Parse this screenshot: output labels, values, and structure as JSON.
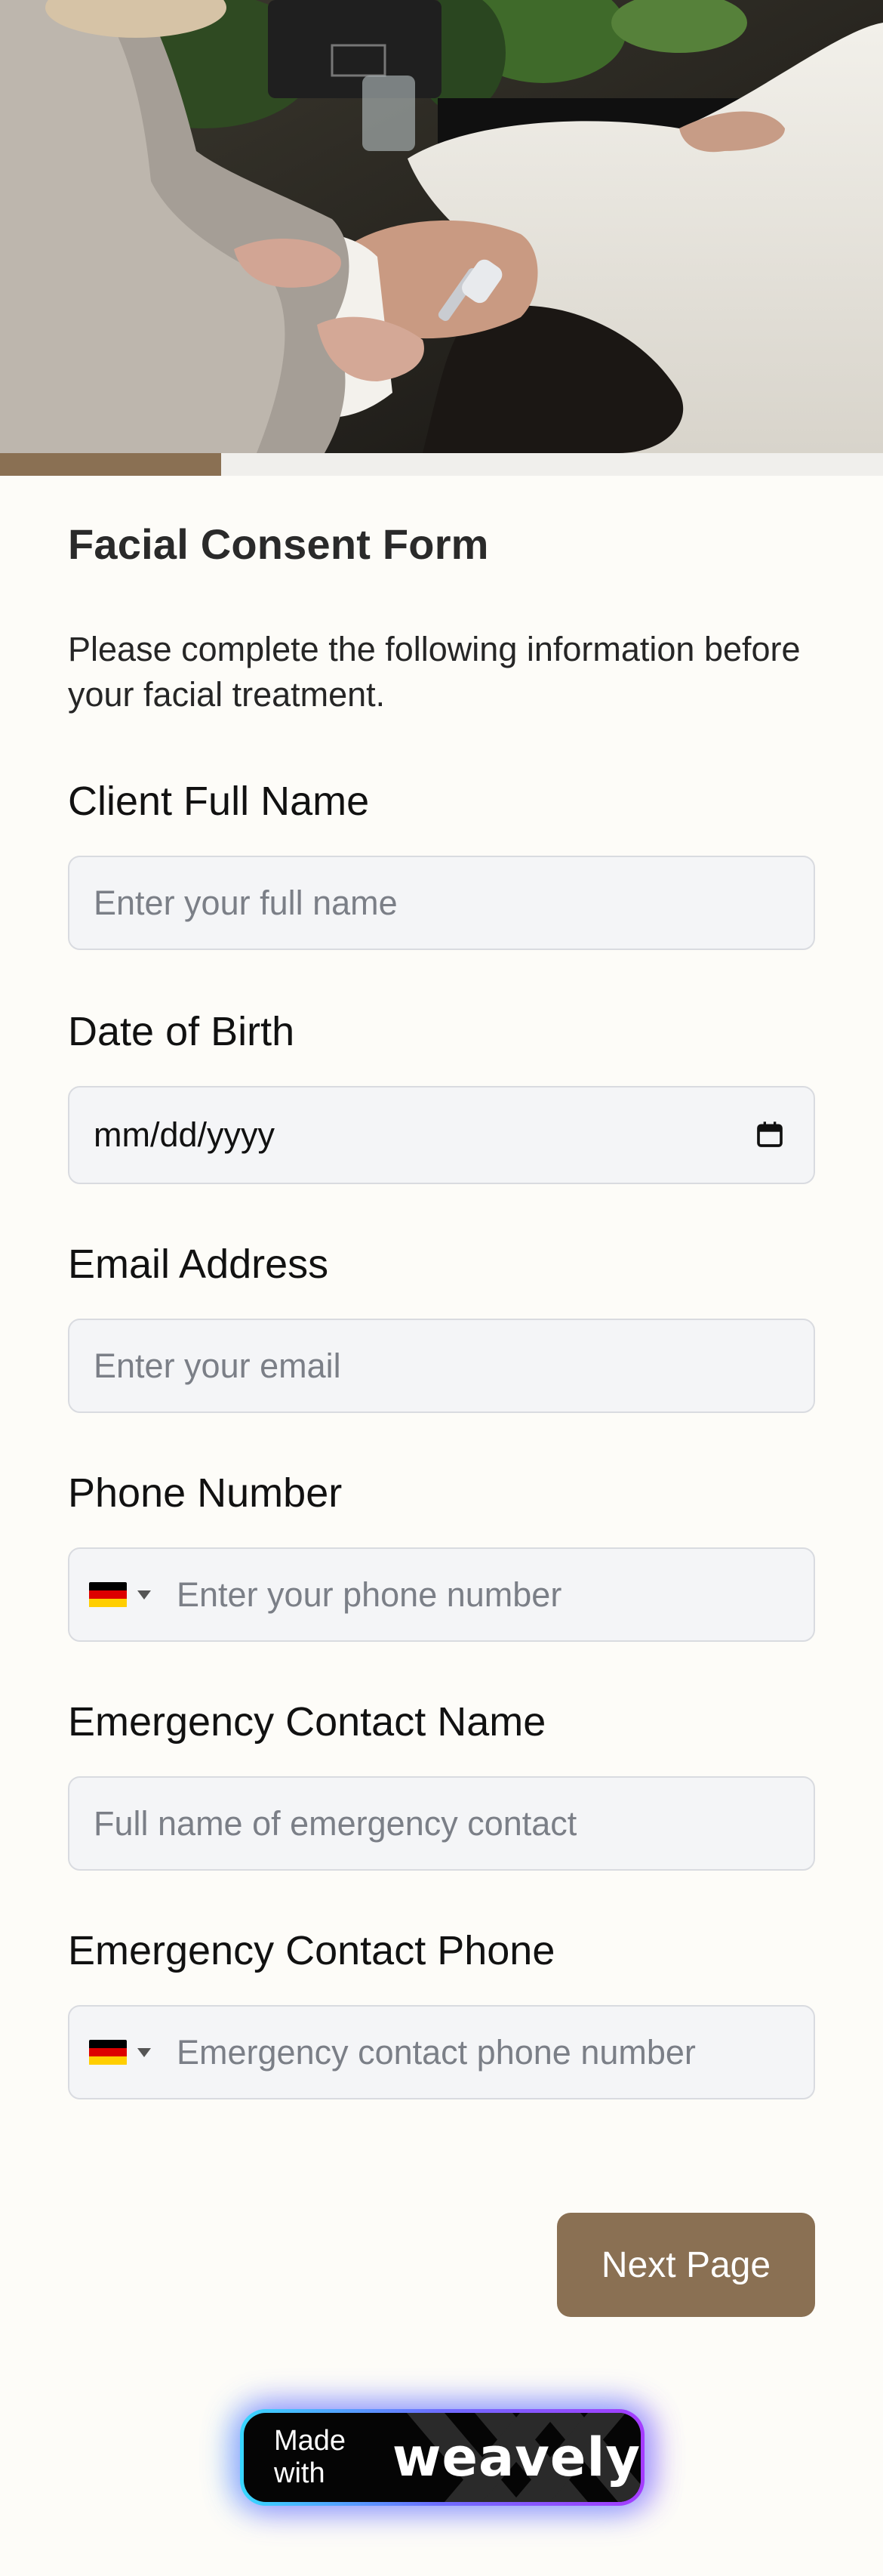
{
  "hero": {
    "image": "facial-treatment-photo"
  },
  "progress": {
    "fraction": 0.25
  },
  "form": {
    "title": "Facial Consent Form",
    "description": "Please complete the following information before your facial treatment.",
    "fields": [
      {
        "label": "Client Full Name",
        "placeholder": "Enter your full name",
        "value": ""
      },
      {
        "label": "Date of Birth",
        "value": "mm/dd/yyyy",
        "icon": "calendar-icon"
      },
      {
        "label": "Email Address",
        "placeholder": "Enter your email",
        "value": ""
      },
      {
        "label": "Phone Number",
        "placeholder": "Enter your phone number",
        "country": "DE",
        "flag_icon": "germany-flag-icon"
      },
      {
        "label": "Emergency Contact Name",
        "placeholder": "Full name of emergency contact",
        "value": ""
      },
      {
        "label": "Emergency Contact Phone",
        "placeholder": "Emergency contact phone number",
        "country": "DE",
        "flag_icon": "germany-flag-icon"
      }
    ],
    "next_label": "Next Page"
  },
  "badge": {
    "prefix": "Made with",
    "brand": "weavely"
  },
  "colors": {
    "accent": "#8a7053",
    "background": "#fdfcf8",
    "input_bg": "#f4f5f7",
    "input_border": "#d9dbe0"
  }
}
